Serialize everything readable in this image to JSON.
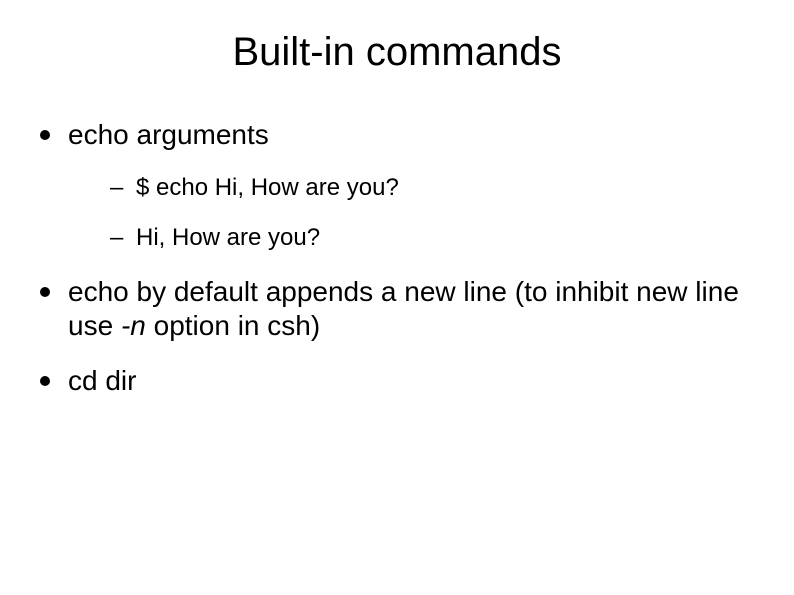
{
  "title": "Built-in commands",
  "bullets": {
    "b1": "echo arguments",
    "sub1": "$ echo Hi, How are you?",
    "sub2": "Hi, How are you?",
    "b2_part1": "echo by default appends a new line (to inhibit new line use ",
    "b2_italic": "-n",
    "b2_part2": " option in csh)",
    "b3": "cd dir"
  }
}
